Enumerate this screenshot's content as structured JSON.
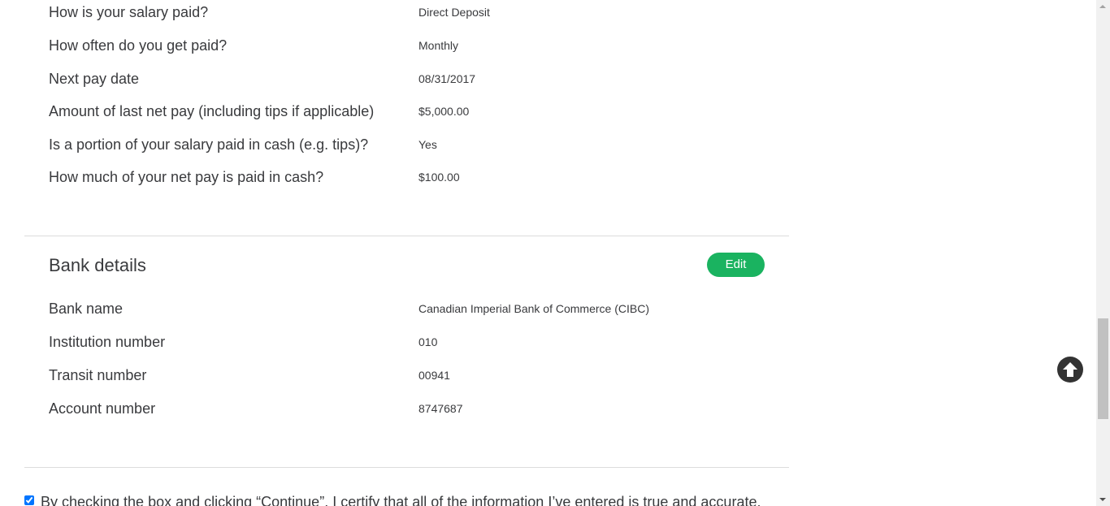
{
  "income": {
    "rows": [
      {
        "label": "How is your salary paid?",
        "value": "Direct Deposit"
      },
      {
        "label": "How often do you get paid?",
        "value": "Monthly"
      },
      {
        "label": "Next pay date",
        "value": "08/31/2017"
      },
      {
        "label": "Amount of last net pay (including tips if applicable)",
        "value": "$5,000.00"
      },
      {
        "label": "Is a portion of your salary paid in cash (e.g. tips)?",
        "value": "Yes"
      },
      {
        "label": "How much of your net pay is paid in cash?",
        "value": "$100.00"
      }
    ]
  },
  "bank": {
    "title": "Bank details",
    "edit_label": "Edit",
    "rows": [
      {
        "label": "Bank name",
        "value": "Canadian Imperial Bank of Commerce (CIBC)"
      },
      {
        "label": "Institution number",
        "value": "010"
      },
      {
        "label": "Transit number",
        "value": "00941"
      },
      {
        "label": "Account number",
        "value": "8747687"
      }
    ]
  },
  "consent": {
    "checked": true,
    "text": "By checking the box and clicking “Continue”, I certify that all of the information I’ve entered is true and accurate."
  },
  "colors": {
    "edit_button": "#1ab360",
    "scroll_top_button": "#333333"
  },
  "icons": {
    "scroll_top": "arrow-up-circle-icon"
  }
}
